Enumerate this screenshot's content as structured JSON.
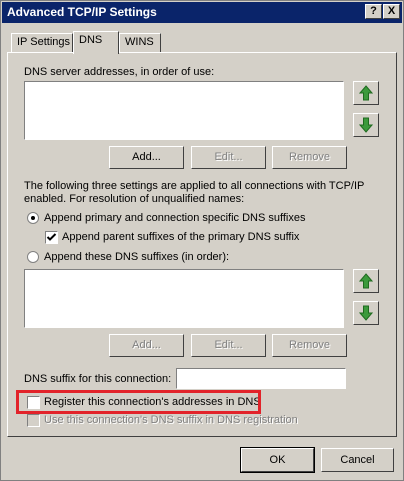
{
  "window": {
    "title": "Advanced TCP/IP Settings",
    "help_label": "?",
    "close_label": "X"
  },
  "tabs": [
    {
      "label": "IP Settings"
    },
    {
      "label": "DNS"
    },
    {
      "label": "WINS"
    }
  ],
  "dns": {
    "servers_label": "DNS server addresses, in order of use:",
    "servers_buttons": {
      "add": "Add...",
      "edit": "Edit...",
      "remove": "Remove"
    },
    "info_line1": "The following three settings are applied to all connections with TCP/IP",
    "info_line2": "enabled. For resolution of unqualified names:",
    "radio_primary": "Append primary and connection specific DNS suffixes",
    "check_parent": "Append parent suffixes of the primary DNS suffix",
    "radio_these": "Append these DNS suffixes (in order):",
    "suffix_buttons": {
      "add": "Add...",
      "edit": "Edit...",
      "remove": "Remove"
    },
    "suffix_label": "DNS suffix for this connection:",
    "suffix_value": "",
    "register_label": "Register this connection's addresses in DNS",
    "use_suffix_label": "Use this connection's DNS suffix in DNS registration"
  },
  "footer": {
    "ok": "OK",
    "cancel": "Cancel"
  },
  "colors": {
    "title_bar": "#0a246a",
    "highlight": "#e2232a",
    "arrow_green": "#3c9a3c"
  }
}
